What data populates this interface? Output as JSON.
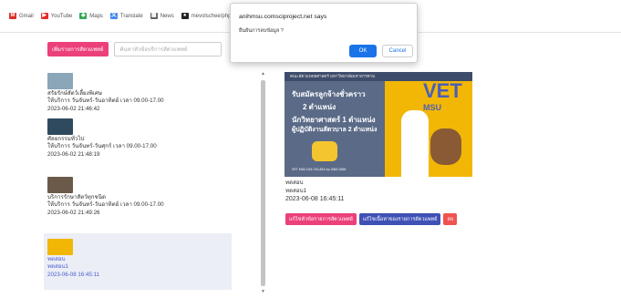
{
  "bookmarks": [
    {
      "label": "Gmail",
      "icon": "gmail-icon",
      "glyph": "M",
      "color": "#d93025"
    },
    {
      "label": "YouTube",
      "icon": "youtube-icon",
      "glyph": "▶",
      "color": "#e52d27"
    },
    {
      "label": "Maps",
      "icon": "maps-icon",
      "glyph": "◆",
      "color": "#34a853"
    },
    {
      "label": "Translate",
      "icon": "translate-icon",
      "glyph": "文",
      "color": "#4285f4"
    },
    {
      "label": "News",
      "icon": "news-icon",
      "glyph": "▦",
      "color": "#5f6368"
    },
    {
      "label": "mevolschee/php-cr...",
      "icon": "github-icon",
      "glyph": "●",
      "color": "#222222"
    }
  ],
  "toolbar": {
    "add_button": "เพิ่มรายการสัตวแพทย์",
    "search_placeholder": "ค้นหาหัวข้อบริการสัตวแพทย์"
  },
  "list": [
    {
      "title": "สรัยรักษ์สัตว์เลี้ยงพิเศษ",
      "hours": "ให้บริการ วันจันทร์-วันอาทิตย์ เวลา 09.00-17.00",
      "date": "2023-06-02 21:46:42",
      "thumb": "#8aa6b8"
    },
    {
      "title": "ศัลยกรรมทั่วไป",
      "hours": "ให้บริการ วันจันทร์-วันศุกร์ เวลา 09.00-17.00",
      "date": "2023-06-02 21:48:19",
      "thumb": "#2f4a5e"
    },
    {
      "title": "บริการรักษาสัตว์ทุกชนิด",
      "hours": "ให้บริการ วันจันทร์-วันอาทิตย์ เวลา 09.00-17.00",
      "date": "2023-06-02 21:49:26",
      "thumb": "#6b5a4a"
    },
    {
      "title": "ทดสอบ",
      "hours": "ทดสอบ1",
      "date": "2023-06-08 16:45:11",
      "thumb": "#f2b705"
    }
  ],
  "poster": {
    "header": "คณะสัตวแพทยศาสตร์ มหาวิทยาลัยมหาสารคาม",
    "line1": "รับสมัครลูกจ้างชั่วคราว",
    "line2": "2 ตำแหน่ง",
    "line3": "นักวิทยาศาสตร์ 1 ตำแหน่ง",
    "line4": "ผู้ปฏิบัติงานสัตวบาล 2 ตำแหน่ง",
    "logo_main": "VET",
    "logo_sub": "MSU",
    "footer": "VET MSU 043-742-823 ต่อ 3363-3369"
  },
  "detail": {
    "title": "ทดสอบ",
    "subtitle": "ทดสอบ1",
    "date": "2023-06-08 16:45:11"
  },
  "actions": {
    "edit_topic": "แก้ไขหัวข้อรายการสัตวแพทย์",
    "edit_content": "แก้ไขเนื้อหาของรายการสัตวแพทย์",
    "delete": "ลบ",
    "colors": {
      "edit_topic": "#ec407a",
      "edit_content": "#3f51b5",
      "delete": "#ef5350"
    }
  },
  "dialog": {
    "title": "anihmsu.comsciproject.net says",
    "message": "ยืนยันการลบข้อมูล ?",
    "ok": "OK",
    "cancel": "Cancel"
  }
}
